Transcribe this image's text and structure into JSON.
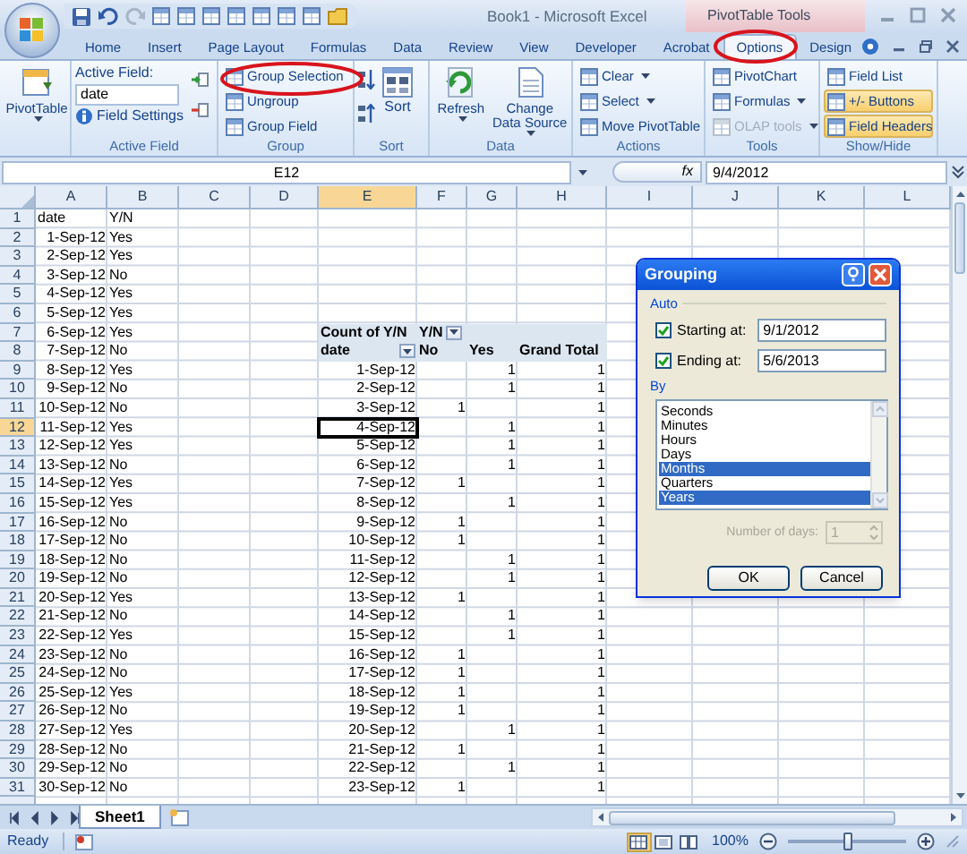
{
  "window": {
    "title": "Book1 - Microsoft Excel",
    "context_title": "PivotTable Tools"
  },
  "tabs": [
    {
      "label": "Home",
      "selected": false
    },
    {
      "label": "Insert",
      "selected": false
    },
    {
      "label": "Page Layout",
      "selected": false
    },
    {
      "label": "Formulas",
      "selected": false
    },
    {
      "label": "Data",
      "selected": false
    },
    {
      "label": "Review",
      "selected": false
    },
    {
      "label": "View",
      "selected": false
    },
    {
      "label": "Developer",
      "selected": false
    },
    {
      "label": "Acrobat",
      "selected": false
    },
    {
      "label": "Options",
      "selected": true
    },
    {
      "label": "Design",
      "selected": false
    }
  ],
  "ribbon": {
    "groups": [
      {
        "kind": "big",
        "buttons": [
          {
            "label": "PivotTable",
            "dropdown": true
          }
        ]
      },
      {
        "kind": "active_field",
        "label": "Active Field",
        "field_label": "Active Field:",
        "value": "date",
        "settings": "Field Settings"
      },
      {
        "kind": "list",
        "label": "Group",
        "items": [
          {
            "label": "Group Selection"
          },
          {
            "label": "Ungroup"
          },
          {
            "label": "Group Field"
          }
        ]
      },
      {
        "kind": "sort",
        "label": "Sort",
        "button": "Sort"
      },
      {
        "kind": "big",
        "label": "Data",
        "buttons": [
          {
            "label": "Refresh",
            "dropdown": true
          },
          {
            "label": "Change Data Source",
            "dropdown": true
          }
        ]
      },
      {
        "kind": "list",
        "label": "Actions",
        "items": [
          {
            "label": "Clear",
            "dropdown": true
          },
          {
            "label": "Select",
            "dropdown": true
          },
          {
            "label": "Move PivotTable"
          }
        ]
      },
      {
        "kind": "list",
        "label": "Tools",
        "items": [
          {
            "label": "PivotChart",
            "dropdown": false,
            "disabled": false
          },
          {
            "label": "Formulas",
            "dropdown": true,
            "disabled": false
          },
          {
            "label": "OLAP tools",
            "dropdown": true,
            "disabled": true
          }
        ]
      },
      {
        "kind": "list",
        "label": "Show/Hide",
        "items": [
          {
            "label": "Field List",
            "selected": false
          },
          {
            "label": "+/- Buttons",
            "selected": true
          },
          {
            "label": "Field Headers",
            "selected": true
          }
        ]
      }
    ]
  },
  "formula_bar": {
    "name_box": "E12",
    "function_label": "fx",
    "formula": "9/4/2012"
  },
  "sheet": {
    "columns": [
      {
        "label": "A",
        "selected": false
      },
      {
        "label": "B",
        "selected": false
      },
      {
        "label": "C",
        "selected": false
      },
      {
        "label": "D",
        "selected": false
      },
      {
        "label": "E",
        "selected": true
      },
      {
        "label": "F",
        "selected": false
      },
      {
        "label": "G",
        "selected": false
      },
      {
        "label": "H",
        "selected": false
      },
      {
        "label": "I",
        "selected": false
      },
      {
        "label": "J",
        "selected": false
      },
      {
        "label": "K",
        "selected": false
      },
      {
        "label": "L",
        "selected": false
      }
    ],
    "row_headers": [
      {
        "label": "1",
        "selected": false
      },
      {
        "label": "2",
        "selected": false
      },
      {
        "label": "3",
        "selected": false
      },
      {
        "label": "4",
        "selected": false
      },
      {
        "label": "5",
        "selected": false
      },
      {
        "label": "6",
        "selected": false
      },
      {
        "label": "7",
        "selected": false
      },
      {
        "label": "8",
        "selected": false
      },
      {
        "label": "9",
        "selected": false
      },
      {
        "label": "10",
        "selected": false
      },
      {
        "label": "11",
        "selected": false
      },
      {
        "label": "12",
        "selected": true
      },
      {
        "label": "13",
        "selected": false
      },
      {
        "label": "14",
        "selected": false
      },
      {
        "label": "15",
        "selected": false
      },
      {
        "label": "16",
        "selected": false
      },
      {
        "label": "17",
        "selected": false
      },
      {
        "label": "18",
        "selected": false
      },
      {
        "label": "19",
        "selected": false
      },
      {
        "label": "20",
        "selected": false
      },
      {
        "label": "21",
        "selected": false
      },
      {
        "label": "22",
        "selected": false
      },
      {
        "label": "23",
        "selected": false
      },
      {
        "label": "24",
        "selected": false
      },
      {
        "label": "25",
        "selected": false
      },
      {
        "label": "26",
        "selected": false
      },
      {
        "label": "27",
        "selected": false
      },
      {
        "label": "28",
        "selected": false
      },
      {
        "label": "29",
        "selected": false
      },
      {
        "label": "30",
        "selected": false
      },
      {
        "label": "31",
        "selected": false
      }
    ],
    "data_table": {
      "header": [
        "date",
        "Y/N"
      ],
      "rows": [
        [
          "1-Sep-12",
          "Yes"
        ],
        [
          "2-Sep-12",
          "Yes"
        ],
        [
          "3-Sep-12",
          "No"
        ],
        [
          "4-Sep-12",
          "Yes"
        ],
        [
          "5-Sep-12",
          "Yes"
        ],
        [
          "6-Sep-12",
          "Yes"
        ],
        [
          "7-Sep-12",
          "No"
        ],
        [
          "8-Sep-12",
          "Yes"
        ],
        [
          "9-Sep-12",
          "No"
        ],
        [
          "10-Sep-12",
          "No"
        ],
        [
          "11-Sep-12",
          "Yes"
        ],
        [
          "12-Sep-12",
          "Yes"
        ],
        [
          "13-Sep-12",
          "No"
        ],
        [
          "14-Sep-12",
          "Yes"
        ],
        [
          "15-Sep-12",
          "Yes"
        ],
        [
          "16-Sep-12",
          "No"
        ],
        [
          "17-Sep-12",
          "No"
        ],
        [
          "18-Sep-12",
          "No"
        ],
        [
          "19-Sep-12",
          "No"
        ],
        [
          "20-Sep-12",
          "Yes"
        ],
        [
          "21-Sep-12",
          "No"
        ],
        [
          "22-Sep-12",
          "Yes"
        ],
        [
          "23-Sep-12",
          "No"
        ],
        [
          "24-Sep-12",
          "No"
        ],
        [
          "25-Sep-12",
          "Yes"
        ],
        [
          "26-Sep-12",
          "No"
        ],
        [
          "27-Sep-12",
          "Yes"
        ],
        [
          "28-Sep-12",
          "No"
        ],
        [
          "29-Sep-12",
          "No"
        ],
        [
          "30-Sep-12",
          "No"
        ]
      ]
    },
    "pivot_table": {
      "value_field": "Count of Y/N",
      "column_field": "Y/N",
      "row_field": "date",
      "column_items": [
        "No",
        "Yes"
      ],
      "total_label": "Grand Total",
      "rows": [
        {
          "label": "1-Sep-12",
          "yes": "1",
          "total": "1"
        },
        {
          "label": "2-Sep-12",
          "yes": "1",
          "total": "1"
        },
        {
          "label": "3-Sep-12",
          "no": "1",
          "total": "1"
        },
        {
          "label": "4-Sep-12",
          "yes": "1",
          "total": "1"
        },
        {
          "label": "5-Sep-12",
          "yes": "1",
          "total": "1"
        },
        {
          "label": "6-Sep-12",
          "yes": "1",
          "total": "1"
        },
        {
          "label": "7-Sep-12",
          "no": "1",
          "total": "1"
        },
        {
          "label": "8-Sep-12",
          "yes": "1",
          "total": "1"
        },
        {
          "label": "9-Sep-12",
          "no": "1",
          "total": "1"
        },
        {
          "label": "10-Sep-12",
          "no": "1",
          "total": "1"
        },
        {
          "label": "11-Sep-12",
          "yes": "1",
          "total": "1"
        },
        {
          "label": "12-Sep-12",
          "yes": "1",
          "total": "1"
        },
        {
          "label": "13-Sep-12",
          "no": "1",
          "total": "1"
        },
        {
          "label": "14-Sep-12",
          "yes": "1",
          "total": "1"
        },
        {
          "label": "15-Sep-12",
          "yes": "1",
          "total": "1"
        },
        {
          "label": "16-Sep-12",
          "no": "1",
          "total": "1"
        },
        {
          "label": "17-Sep-12",
          "no": "1",
          "total": "1"
        },
        {
          "label": "18-Sep-12",
          "no": "1",
          "total": "1"
        },
        {
          "label": "19-Sep-12",
          "no": "1",
          "total": "1"
        },
        {
          "label": "20-Sep-12",
          "yes": "1",
          "total": "1"
        },
        {
          "label": "21-Sep-12",
          "no": "1",
          "total": "1"
        },
        {
          "label": "22-Sep-12",
          "yes": "1",
          "total": "1"
        },
        {
          "label": "23-Sep-12",
          "no": "1",
          "total": "1"
        }
      ]
    }
  },
  "sheet_tabs": [
    {
      "label": "Sheet1",
      "selected": true
    }
  ],
  "status_bar": {
    "status": "Ready",
    "views": [
      {
        "kind": "normal",
        "selected": true
      },
      {
        "kind": "page_layout",
        "selected": false
      },
      {
        "kind": "page_break",
        "selected": false
      }
    ],
    "zoom_label": "100%",
    "zoom_slider": {
      "level": 0.5
    }
  },
  "dialog": {
    "title": "Grouping",
    "auto_label": "Auto",
    "start": {
      "label": "Starting at:",
      "checked": true,
      "value": "9/1/2012"
    },
    "end": {
      "label": "Ending at:",
      "checked": true,
      "value": "5/6/2013"
    },
    "by_label": "By",
    "by_options": [
      {
        "label": "Seconds",
        "selected": false
      },
      {
        "label": "Minutes",
        "selected": false
      },
      {
        "label": "Hours",
        "selected": false
      },
      {
        "label": "Days",
        "selected": false
      },
      {
        "label": "Months",
        "selected": true
      },
      {
        "label": "Quarters",
        "selected": false
      },
      {
        "label": "Years",
        "selected": true
      }
    ],
    "days": {
      "label": "Number of days:",
      "value": "1",
      "disabled": true
    },
    "buttons": [
      "OK",
      "Cancel"
    ]
  }
}
